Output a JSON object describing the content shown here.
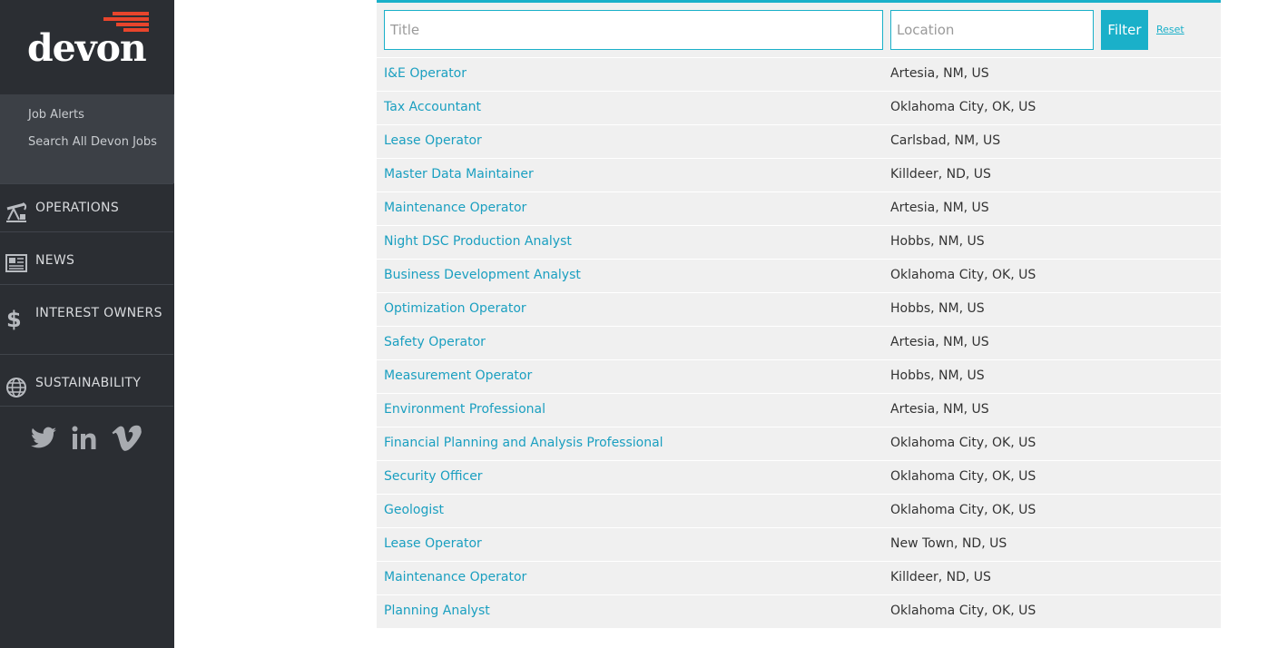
{
  "brand": {
    "logo_text": "devon",
    "accent_color": "#e8452c"
  },
  "sidebar": {
    "submenu": [
      {
        "label": "Job Alerts"
      },
      {
        "label": "Search All Devon Jobs"
      }
    ],
    "nav": [
      {
        "label": "OPERATIONS",
        "icon": "pumpjack-icon"
      },
      {
        "label": "NEWS",
        "icon": "newspaper-icon"
      },
      {
        "label": "INTEREST OWNERS",
        "icon": "dollar-icon"
      },
      {
        "label": "SUSTAINABILITY",
        "icon": "globe-icon"
      }
    ],
    "social": [
      "twitter-icon",
      "linkedin-icon",
      "vimeo-icon"
    ]
  },
  "search": {
    "title_placeholder": "Title",
    "location_placeholder": "Location",
    "filter_label": "Filter",
    "reset_label": "Reset"
  },
  "jobs": [
    {
      "title": "I&E Operator",
      "location": "Artesia, NM, US"
    },
    {
      "title": "Tax Accountant",
      "location": "Oklahoma City, OK, US"
    },
    {
      "title": "Lease Operator",
      "location": "Carlsbad, NM, US"
    },
    {
      "title": "Master Data Maintainer",
      "location": "Killdeer, ND, US"
    },
    {
      "title": "Maintenance Operator",
      "location": "Artesia, NM, US"
    },
    {
      "title": "Night DSC Production Analyst",
      "location": "Hobbs, NM, US"
    },
    {
      "title": "Business Development Analyst",
      "location": "Oklahoma City, OK, US"
    },
    {
      "title": "Optimization Operator",
      "location": "Hobbs, NM, US"
    },
    {
      "title": "Safety Operator",
      "location": "Artesia, NM, US"
    },
    {
      "title": "Measurement Operator",
      "location": "Hobbs, NM, US"
    },
    {
      "title": "Environment Professional",
      "location": "Artesia, NM, US"
    },
    {
      "title": "Financial Planning and Analysis Professional",
      "location": "Oklahoma City, OK, US"
    },
    {
      "title": "Security Officer",
      "location": "Oklahoma City, OK, US"
    },
    {
      "title": "Geologist",
      "location": "Oklahoma City, OK, US"
    },
    {
      "title": "Lease Operator",
      "location": "New Town, ND, US"
    },
    {
      "title": "Maintenance Operator",
      "location": "Killdeer, ND, US"
    },
    {
      "title": "Planning Analyst",
      "location": "Oklahoma City, OK, US"
    }
  ]
}
